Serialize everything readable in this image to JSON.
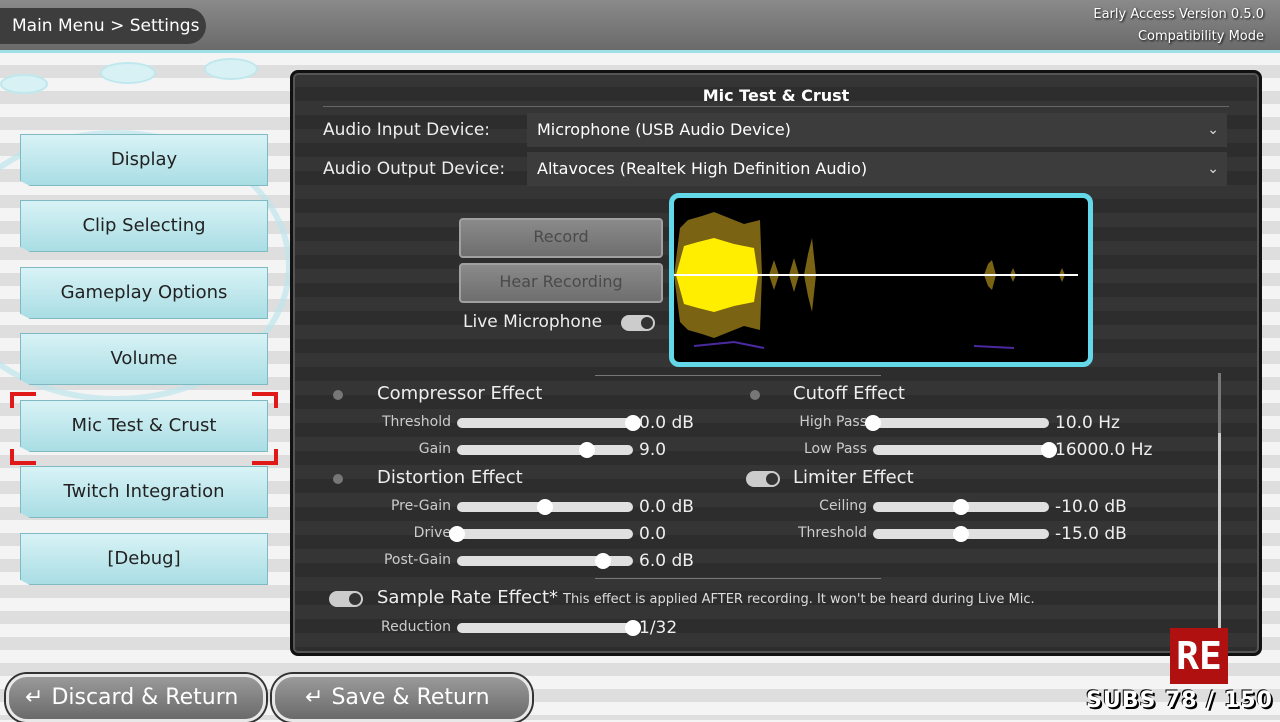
{
  "header": {
    "breadcrumb": "Main Menu > Settings",
    "version_line1": "Early Access Version 0.5.0",
    "version_line2": "Compatibility Mode"
  },
  "sidebar": {
    "items": [
      {
        "label": "Display"
      },
      {
        "label": "Clip Selecting"
      },
      {
        "label": "Gameplay Options"
      },
      {
        "label": "Volume"
      },
      {
        "label": "Mic Test & Crust",
        "selected": true
      },
      {
        "label": "Twitch Integration"
      },
      {
        "label": "[Debug]"
      }
    ]
  },
  "panel": {
    "title": "Mic Test & Crust",
    "audio_input": {
      "label": "Audio Input Device:",
      "value": "Microphone (USB Audio Device)"
    },
    "audio_output": {
      "label": "Audio Output Device:",
      "value": "Altavoces (Realtek High Definition Audio)"
    },
    "record_label": "Record",
    "hear_label": "Hear Recording",
    "live_mic_label": "Live Microphone",
    "live_mic_on": true,
    "compressor": {
      "title": "Compressor Effect",
      "enabled": false,
      "threshold": {
        "label": "Threshold",
        "value": "0.0 dB",
        "level": 1.0
      },
      "gain": {
        "label": "Gain",
        "value": "9.0",
        "level": 0.74
      }
    },
    "cutoff": {
      "title": "Cutoff Effect",
      "enabled": false,
      "high_pass": {
        "label": "High Pass",
        "value": "10.0 Hz",
        "level": 0.0
      },
      "low_pass": {
        "label": "Low Pass",
        "value": "16000.0 Hz",
        "level": 1.0
      }
    },
    "distortion": {
      "title": "Distortion Effect",
      "enabled": false,
      "pre_gain": {
        "label": "Pre-Gain",
        "value": "0.0 dB",
        "level": 0.5
      },
      "drive": {
        "label": "Drive",
        "value": "0.0",
        "level": 0.0
      },
      "post_gain": {
        "label": "Post-Gain",
        "value": "6.0 dB",
        "level": 0.83
      }
    },
    "limiter": {
      "title": "Limiter Effect",
      "enabled": true,
      "ceiling": {
        "label": "Ceiling",
        "value": "-10.0 dB",
        "level": 0.5
      },
      "threshold": {
        "label": "Threshold",
        "value": "-15.0 dB",
        "level": 0.5
      }
    },
    "sample_rate": {
      "title": "Sample Rate Effect*",
      "enabled": true,
      "note": "This effect is applied AFTER recording. It won't be heard during Live Mic.",
      "reduction": {
        "label": "Reduction",
        "value": "1/32",
        "level": 1.0
      }
    }
  },
  "footer": {
    "discard_label": "Discard & Return",
    "save_label": "Save & Return",
    "logo_text": "RE",
    "subs_text": "SUBS 78 / 150"
  },
  "colors": {
    "accent": "#62d8e8",
    "nav_button": "#b8e6ec",
    "selection": "#e01818",
    "waveform": "#ffee00"
  }
}
